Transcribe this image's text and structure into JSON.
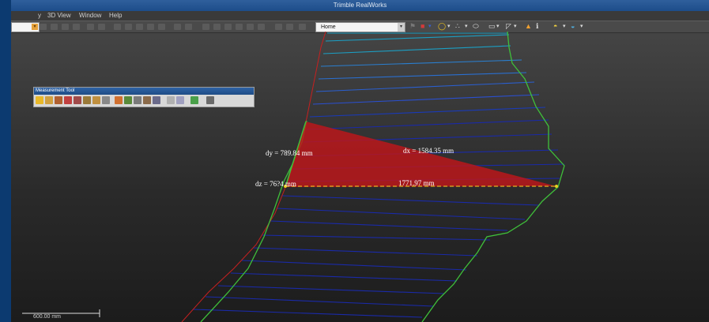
{
  "window": {
    "title": "Trimble RealWorks"
  },
  "menu": {
    "items": [
      "y",
      "3D View",
      "Window",
      "Help"
    ]
  },
  "toolbar": {
    "view_combo": "Home"
  },
  "measurement_tool": {
    "title": "Measurement Tool"
  },
  "measurements": {
    "dy": "dy = 789.84 mm",
    "dx": "dx = 1584.35 mm",
    "dz": "dz = 76?4 mm",
    "total": "1771.97 mm"
  },
  "scale_bar": {
    "label": "600.00 mm"
  },
  "colors": {
    "triangle": "#c0161a",
    "hatch_blue": "#1a2aa8",
    "hatch_cyan": "#1b9fc4",
    "edge_green": "#3fbf3a",
    "edge_red": "#c62020",
    "dashed": "#e8b020"
  }
}
